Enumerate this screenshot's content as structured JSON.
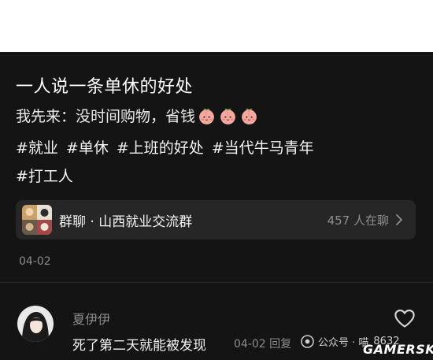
{
  "post": {
    "title": "一人说一条单休的好处",
    "body_text": "我先来：没时间购物，省钱",
    "emoji": [
      "peach-face",
      "peach-face",
      "peach-face"
    ],
    "tags": [
      "#就业",
      "#单休",
      "#上班的好处",
      "#当代牛马青年",
      "#打工人"
    ],
    "date": "04-02"
  },
  "group_chat": {
    "label": "群聊 · 山西就业交流群",
    "member_count": "457 人在聊"
  },
  "comment": {
    "username": "夏伊伊",
    "text": "死了第二天就能被发现",
    "meta": "04-02 回复"
  },
  "watermark": {
    "account": "公众号 · 喵",
    "count": "8632",
    "logo": "GAMERSKY"
  },
  "colors": {
    "background": "#141414",
    "card": "#262626",
    "text_primary": "#f2f2f2",
    "text_secondary": "#8c8c8c"
  }
}
